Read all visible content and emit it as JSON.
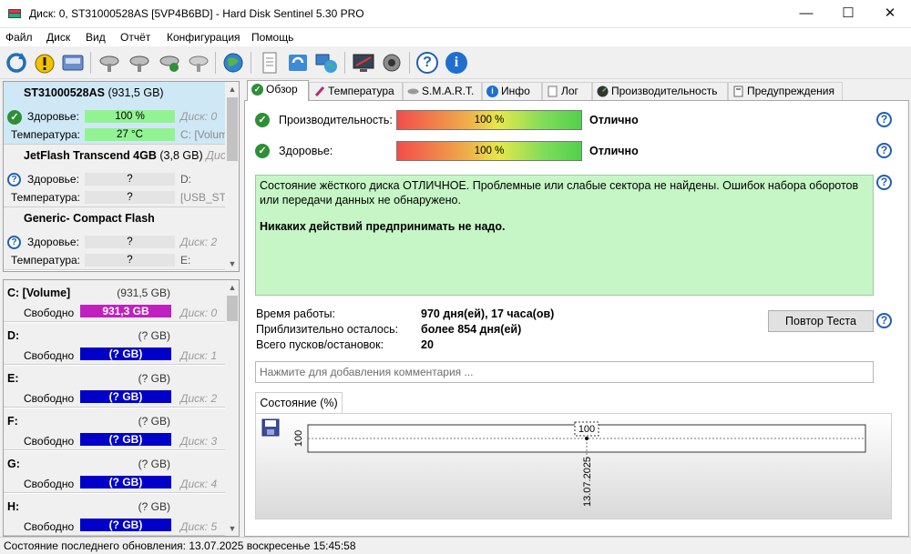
{
  "window": {
    "title": "Диск: 0, ST31000528AS [5VP4B6BD]  -  Hard Disk Sentinel 5.30 PRO",
    "minimize": "—",
    "maximize": "☐",
    "close": "✕"
  },
  "menu": [
    "Файл",
    "Диск",
    "Вид",
    "Отчёт",
    "Конфигурация",
    "Помощь"
  ],
  "toolbar_icons": [
    "refresh-icon",
    "alert-icon",
    "drive-icon",
    "disk-test-icon-1",
    "disk-test-icon-2",
    "disk-test-icon-3",
    "disk-test-icon-4",
    "globe-icon",
    "report-icon",
    "sync-icon",
    "network-icon",
    "monitor-report-icon",
    "speaker-icon",
    "help-icon",
    "info-icon"
  ],
  "disks": [
    {
      "name": "ST31000528AS",
      "size": "(931,5 GB)",
      "health_label": "Здоровье:",
      "health": "100 %",
      "health_disk": "Диск: 0",
      "temp_label": "Температура:",
      "temp": "27 °C",
      "temp_disk": "C: [Volum",
      "status": "ok",
      "selected": true
    },
    {
      "name": "JetFlash Transcend 4GB",
      "size": "(3,8 GB)",
      "health_label": "Здоровье:",
      "health": "?",
      "health_disk": "D:",
      "temp_label": "Температура:",
      "temp": "?",
      "temp_disk": "[USB_STI",
      "status": "unknown",
      "name_suffix": "Диск"
    },
    {
      "name": "Generic- Compact Flash",
      "size": "",
      "health_label": "Здоровье:",
      "health": "?",
      "health_disk": "Диск: 2",
      "temp_label": "Температура:",
      "temp": "?",
      "temp_disk": "E:",
      "status": "unknown"
    }
  ],
  "volumes": [
    {
      "name": "C: [Volume]",
      "size": "(931,5 GB)",
      "free_label": "Свободно",
      "free": "931,3 GB",
      "disk": "Диск: 0",
      "bar_color": "#c020c0"
    },
    {
      "name": "D:",
      "size": "(? GB)",
      "free_label": "Свободно",
      "free": "(? GB)",
      "disk": "Диск: 1",
      "bar_color": "#0000c8"
    },
    {
      "name": "E:",
      "size": "(? GB)",
      "free_label": "Свободно",
      "free": "(? GB)",
      "disk": "Диск: 2",
      "bar_color": "#0000c8"
    },
    {
      "name": "F:",
      "size": "(? GB)",
      "free_label": "Свободно",
      "free": "(? GB)",
      "disk": "Диск: 3",
      "bar_color": "#0000c8"
    },
    {
      "name": "G:",
      "size": "(? GB)",
      "free_label": "Свободно",
      "free": "(? GB)",
      "disk": "Диск: 4",
      "bar_color": "#0000c8"
    },
    {
      "name": "H:",
      "size": "(? GB)",
      "free_label": "Свободно",
      "free": "(? GB)",
      "disk": "Диск: 5",
      "bar_color": "#0000c8"
    }
  ],
  "tabs": [
    {
      "label": "Обзор",
      "icon": "ok-icon",
      "active": true
    },
    {
      "label": "Температура",
      "icon": "thermometer-icon"
    },
    {
      "label": "S.M.A.R.T.",
      "icon": "smart-icon"
    },
    {
      "label": "Инфо",
      "icon": "info-icon"
    },
    {
      "label": "Лог",
      "icon": "log-icon"
    },
    {
      "label": "Производительность",
      "icon": "speedometer-icon"
    },
    {
      "label": "Предупреждения",
      "icon": "warnings-icon"
    }
  ],
  "overview": {
    "performance_label": "Производительность:",
    "performance_value": "100 %",
    "performance_status": "Отлично",
    "health_label": "Здоровье:",
    "health_value": "100 %",
    "health_status": "Отлично",
    "status_text": "Состояние жёсткого диска ОТЛИЧНОЕ. Проблемные или слабые сектора не найдены. Ошибок набора оборотов или передачи данных не обнаружено.",
    "status_action": "Никаких действий предпринимать не надо.",
    "uptime_label": "Время работы:",
    "uptime_value": "970 дня(ей), 17 часа(ов)",
    "remaining_label": "Приблизительно осталось:",
    "remaining_value": "более 854 дня(ей)",
    "starts_label": "Всего пусков/остановок:",
    "starts_value": "20",
    "retest_label": "Повтор Теста",
    "comment_placeholder": "Нажмите для добавления комментария ..."
  },
  "chart_tab_label": "Состояние (%)",
  "chart_data": {
    "type": "line",
    "x": [
      "13.07.2025"
    ],
    "series": [
      {
        "values": [
          100
        ]
      }
    ],
    "y_tick": "100",
    "point_label": "100",
    "x_tick": "13.07.2025"
  },
  "statusbar": {
    "text": "Состояние последнего обновления: 13.07.2025 воскресенье 15:45:58"
  }
}
